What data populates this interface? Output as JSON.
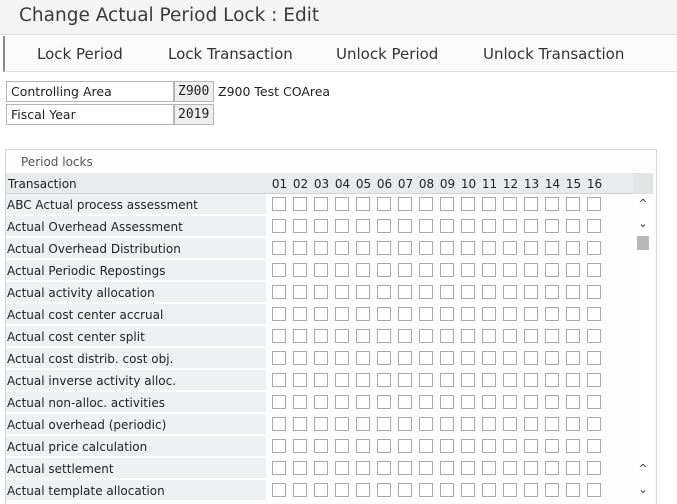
{
  "window": {
    "title": "Change Actual Period Lock : Edit"
  },
  "toolbar": {
    "lock_period": "Lock Period",
    "lock_transaction": "Lock Transaction",
    "unlock_period": "Unlock Period",
    "unlock_transaction": "Unlock Transaction"
  },
  "header_fields": {
    "controlling_area": {
      "label": "Controlling Area",
      "value": "Z900",
      "description": "Z900 Test COArea"
    },
    "fiscal_year": {
      "label": "Fiscal Year",
      "value": "2019"
    }
  },
  "period_locks": {
    "title": "Period locks",
    "transaction_header": "Transaction",
    "periods": [
      "01",
      "02",
      "03",
      "04",
      "05",
      "06",
      "07",
      "08",
      "09",
      "10",
      "11",
      "12",
      "13",
      "14",
      "15",
      "16"
    ],
    "rows": [
      "ABC Actual process assessment",
      "Actual Overhead Assessment",
      "Actual Overhead Distribution",
      "Actual Periodic Repostings",
      "Actual activity allocation",
      "Actual cost center accrual",
      "Actual cost center split",
      "Actual cost distrib. cost obj.",
      "Actual inverse activity alloc.",
      "Actual non-alloc. activities",
      "Actual overhead (periodic)",
      "Actual price calculation",
      "Actual settlement",
      "Actual template allocation"
    ]
  },
  "icons": {
    "scroll_up": "chevron-up-icon",
    "scroll_down": "chevron-down-icon"
  }
}
